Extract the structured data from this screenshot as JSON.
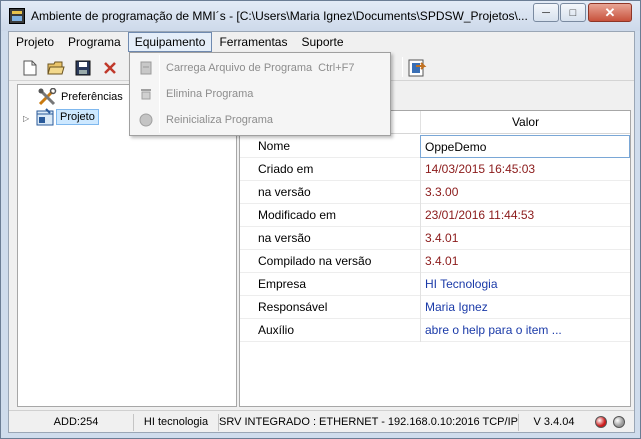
{
  "window": {
    "title": "Ambiente de programação de MMI´s - [C:\\Users\\Maria Ignez\\Documents\\SPDSW_Projetos\\...",
    "icon": "app-window-icon"
  },
  "menu": [
    {
      "label": "Projeto"
    },
    {
      "label": "Programa"
    },
    {
      "label": "Equipamento"
    },
    {
      "label": "Ferramentas"
    },
    {
      "label": "Suporte"
    }
  ],
  "toolbar": {
    "icons": [
      "new-file-icon",
      "open-folder-icon",
      "save-icon",
      "delete-icon",
      "export-project-icon"
    ]
  },
  "dropdown": {
    "items": [
      {
        "label": "Carrega Arquivo de Programa",
        "shortcut": "Ctrl+F7",
        "icon": "upload-icon",
        "enabled": false
      },
      {
        "label": "Elimina Programa",
        "shortcut": "",
        "icon": "erase-icon",
        "enabled": false
      },
      {
        "label": "Reinicializa Programa",
        "shortcut": "",
        "icon": "reset-icon",
        "enabled": false
      }
    ]
  },
  "tree": {
    "nodes": [
      {
        "label": "Preferências",
        "icon": "tools-icon"
      },
      {
        "label": "Projeto",
        "icon": "project-icon",
        "selected": true
      }
    ]
  },
  "grid": {
    "header": {
      "valor": "Valor"
    },
    "rows": [
      {
        "name": "Nome",
        "value": "OppeDemo"
      },
      {
        "name": "Criado em",
        "value": "14/03/2015 16:45:03"
      },
      {
        "name": "na versão",
        "value": "3.3.00"
      },
      {
        "name": "Modificado em",
        "value": "23/01/2016 11:44:53"
      },
      {
        "name": "na versão",
        "value": "3.4.01"
      },
      {
        "name": "Compilado na versão",
        "value": "3.4.01"
      },
      {
        "name": "Empresa",
        "value": "HI Tecnologia"
      },
      {
        "name": "Responsável",
        "value": "Maria Ignez"
      },
      {
        "name": "Auxílio",
        "value": "abre o help para o item ..."
      }
    ]
  },
  "status": {
    "address": "ADD:254",
    "company": "HI tecnologia",
    "connection": "SRV INTEGRADO : ETHERNET - 192.168.0.10:2016 TCP/IP",
    "version": "V 3.4.04",
    "led_colors": [
      "#cc1a1a",
      "#9a9a9a"
    ]
  },
  "colors": {
    "value_dark": "#8b1a1a",
    "value_blue": "#1a3aa8"
  }
}
